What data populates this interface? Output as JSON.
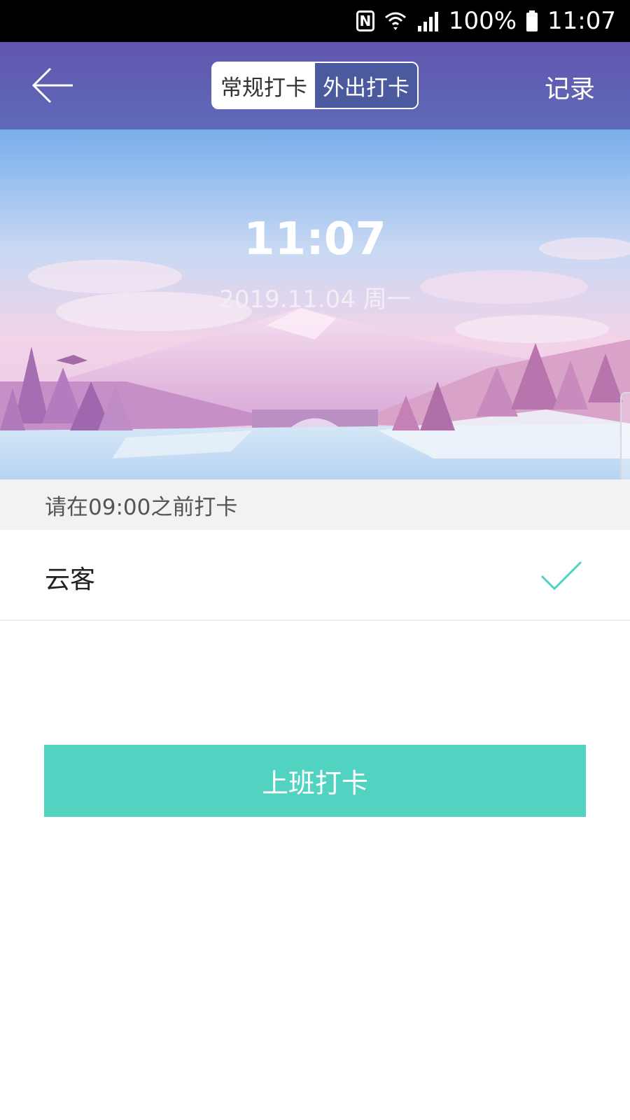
{
  "status_bar": {
    "nfc_letter": "N",
    "battery_percent": "100%",
    "time": "11:07",
    "icons": [
      "nfc-icon",
      "wifi-icon",
      "signal-icon",
      "battery-icon"
    ]
  },
  "header": {
    "back_icon": "back-arrow-icon",
    "tabs": [
      {
        "label": "常规打卡",
        "selected": false
      },
      {
        "label": "外出打卡",
        "selected": true
      }
    ],
    "record_label": "记录"
  },
  "hero": {
    "time": "11:07",
    "date": "2019.11.04  周一"
  },
  "notice": {
    "text": "请在09:00之前打卡"
  },
  "location": {
    "name": "云客",
    "check_icon": "check-icon",
    "check_color": "#4fd1c3"
  },
  "punch_button": {
    "label": "上班打卡",
    "color": "#52d3c2"
  }
}
